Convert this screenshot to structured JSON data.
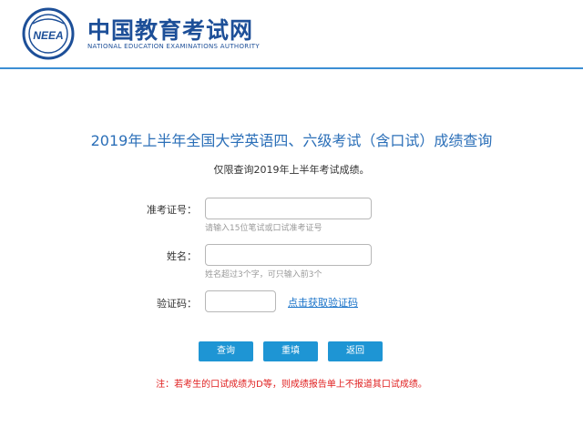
{
  "header": {
    "title_cn": "中国教育考试网",
    "title_en": "NATIONAL EDUCATION EXAMINATIONS AUTHORITY",
    "logo_text": "NEEA",
    "brand_color": "#1d4f98",
    "rule_color": "#3c8fd4"
  },
  "main": {
    "title": "2019年上半年全国大学英语四、六级考试（含口试）成绩查询",
    "subtitle": "仅限查询2019年上半年考试成绩。"
  },
  "form": {
    "ticket": {
      "label": "准考证号：",
      "value": "",
      "hint": "请输入15位笔试或口试准考证号"
    },
    "name": {
      "label": "姓名：",
      "value": "",
      "hint": "姓名超过3个字，可只输入前3个"
    },
    "captcha": {
      "label": "验证码：",
      "value": "",
      "link": "点击获取验证码"
    }
  },
  "buttons": {
    "query": "查询",
    "reset": "重填",
    "back": "返回",
    "color": "#1e95d4"
  },
  "note": "注：若考生的口试成绩为D等，则成绩报告单上不报道其口试成绩。"
}
